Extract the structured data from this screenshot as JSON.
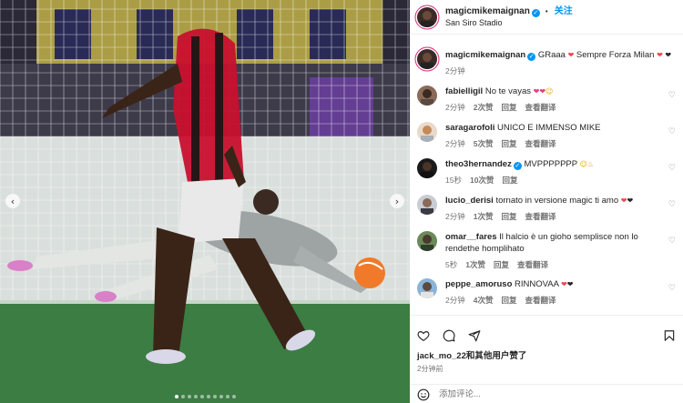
{
  "photo": {
    "prev_arrow": "‹",
    "next_arrow": "›",
    "slide_count": 10,
    "active_slide": 1,
    "colors": {
      "grass": "#3c7d44",
      "ball": "#f07a2a",
      "jersey_red": "#c8102e"
    }
  },
  "header": {
    "username": "magicmikemaignan",
    "verified_mark": "✓",
    "dot": "•",
    "follow_label": "关注",
    "location": "San Siro Stadio"
  },
  "caption": {
    "username": "magicmikemaignan",
    "verified_mark": "✓",
    "text": "GRaaa",
    "emoji_mid": "❤",
    "text2": "Sempre Forza Milan",
    "hearts": [
      "❤",
      "❤"
    ],
    "time": "2分钟"
  },
  "comments": [
    {
      "username": "fabielligil",
      "text": "No te vayas",
      "emojis": [
        "❤",
        "❤",
        "☺"
      ],
      "time": "2分钟",
      "likes": "2次赞",
      "reply": "回复",
      "translate": "查看翻译"
    },
    {
      "username": "saragarofoli",
      "text": "UNICO E IMMENSO MIKE",
      "emojis": [],
      "time": "2分钟",
      "likes": "5次赞",
      "reply": "回复",
      "translate": "查看翻译"
    },
    {
      "username": "theo3hernandez",
      "verified_mark": "✓",
      "text": "MVPPPPPPP",
      "emojis": [
        "☺",
        "♨"
      ],
      "time": "15秒",
      "likes": "10次赞",
      "reply": "回复",
      "translate": ""
    },
    {
      "username": "lucio_derisi",
      "text": "tornato in versione magic ti amo",
      "emojis": [
        "❤",
        "❤"
      ],
      "time": "2分钟",
      "likes": "1次赞",
      "reply": "回复",
      "translate": "查看翻译"
    },
    {
      "username": "omar__fares",
      "text": "Il halcio è un gioho semplisce non lo rendethe homplihato",
      "emojis": [],
      "time": "5秒",
      "likes": "1次赞",
      "reply": "回复",
      "translate": "查看翻译"
    },
    {
      "username": "peppe_amoruso",
      "text": "RINNOVAA",
      "emojis": [
        "❤",
        "❤"
      ],
      "time": "2分钟",
      "likes": "4次赞",
      "reply": "回复",
      "translate": "查看翻译"
    }
  ],
  "actions": {
    "liked_by_user": "jack_mo_22",
    "liked_by_suffix": "和其他用户赞了",
    "time": "2分钟前",
    "comment_placeholder": "添加评论..."
  }
}
